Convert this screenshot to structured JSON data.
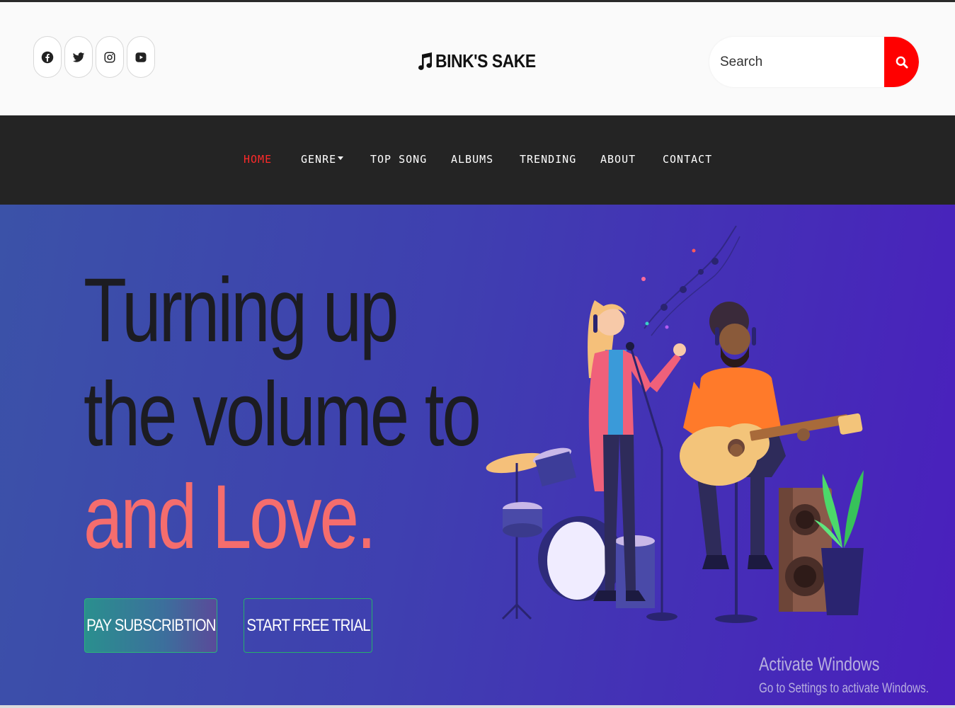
{
  "header": {
    "socials": [
      {
        "icon": "facebook-icon"
      },
      {
        "icon": "twitter-icon"
      },
      {
        "icon": "instagram-icon"
      },
      {
        "icon": "youtube-icon"
      }
    ],
    "logo": {
      "icon": "music-note-icon",
      "text": "BINK'S SAKE"
    },
    "search": {
      "placeholder": "Search",
      "value": "",
      "button_icon": "search-icon"
    }
  },
  "nav": {
    "items": [
      {
        "label": "HOME",
        "active": true
      },
      {
        "label": "GENRE",
        "has_dropdown": true
      },
      {
        "label": "TOP SONG"
      },
      {
        "label": "ALBUMS"
      },
      {
        "label": "TRENDING"
      },
      {
        "label": "ABOUT"
      },
      {
        "label": "CONTACT"
      }
    ]
  },
  "hero": {
    "headline_line1": "Turning up",
    "headline_line2": "the volume to",
    "headline_line3": "and Love.",
    "buttons": {
      "pay": "PAY SUBSCRIBTION",
      "trial": "START FREE TRIAL"
    },
    "illustration": "musicians-illustration"
  },
  "watermark": {
    "title": "Activate Windows",
    "subtitle": "Go to Settings to activate Windows."
  },
  "colors": {
    "accent": "#ff0000",
    "nav_bg": "#242424",
    "headline_highlight": "#f56d6d",
    "hero_gradient_start": "#3b52a8",
    "hero_gradient_end": "#4a1fbd"
  }
}
